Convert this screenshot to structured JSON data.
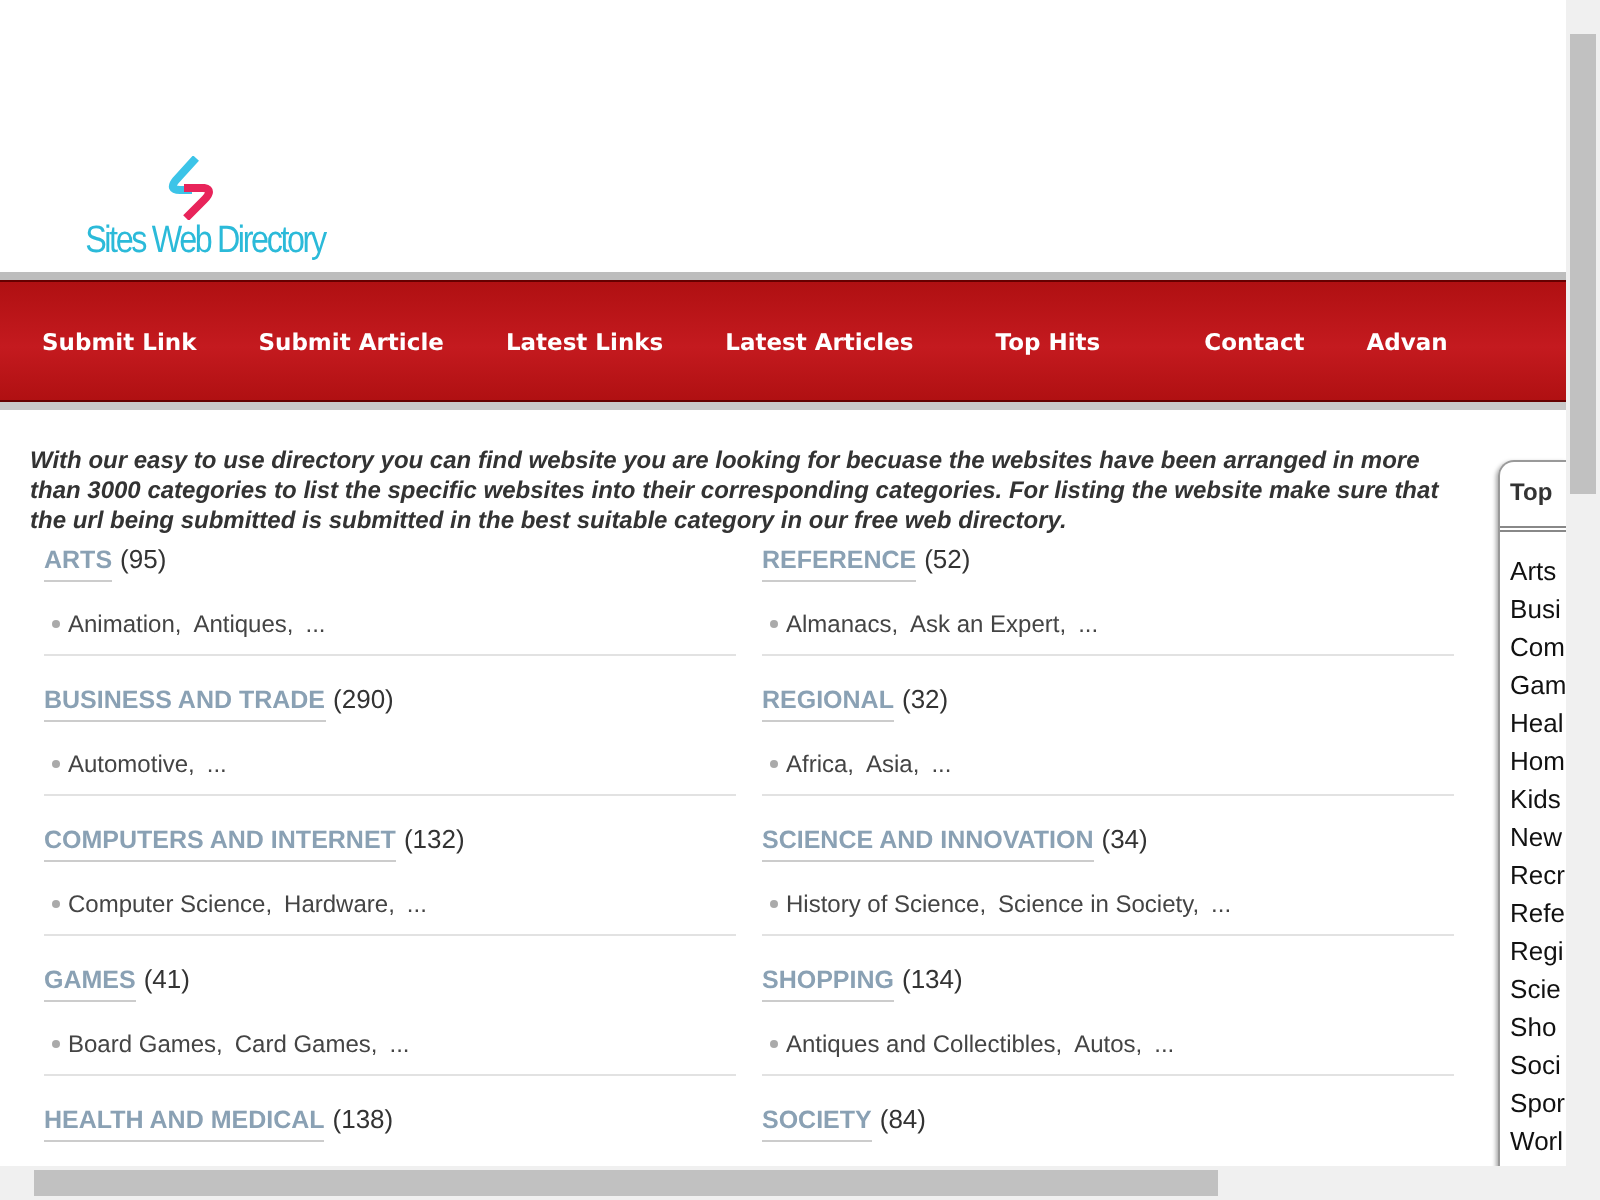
{
  "logo": {
    "text": "Sites Web Directory"
  },
  "nav": [
    "Submit Link",
    "Submit Article",
    "Latest Links",
    "Latest Articles",
    "Top Hits",
    "Contact",
    "Advan"
  ],
  "intro": "With our easy to use directory you can find website you are looking for becuase the websites have been arranged in more than 3000 categories to list the specific websites into their corresponding categories. For listing the website make sure that the url being submitted is submitted in the best suitable category in our free web directory.",
  "categories": [
    {
      "name": "ARTS",
      "count": "(95)",
      "subs": [
        "Animation,",
        "Antiques,",
        "..."
      ]
    },
    {
      "name": "REFERENCE",
      "count": "(52)",
      "subs": [
        "Almanacs,",
        "Ask an Expert,",
        "..."
      ]
    },
    {
      "name": "BUSINESS AND TRADE",
      "count": "(290)",
      "subs": [
        "Automotive,",
        "..."
      ]
    },
    {
      "name": "REGIONAL",
      "count": "(32)",
      "subs": [
        "Africa,",
        "Asia,",
        "..."
      ]
    },
    {
      "name": "COMPUTERS AND INTERNET",
      "count": "(132)",
      "subs": [
        "Computer Science,",
        "Hardware,",
        "..."
      ]
    },
    {
      "name": "SCIENCE AND INNOVATION",
      "count": "(34)",
      "subs": [
        "History of Science,",
        "Science in Society,",
        "..."
      ]
    },
    {
      "name": "GAMES",
      "count": "(41)",
      "subs": [
        "Board Games,",
        "Card Games,",
        "..."
      ]
    },
    {
      "name": "SHOPPING",
      "count": "(134)",
      "subs": [
        "Antiques and Collectibles,",
        "Autos,",
        "..."
      ]
    },
    {
      "name": "HEALTH AND MEDICAL",
      "count": "(138)"
    },
    {
      "name": "SOCIETY",
      "count": "(84)"
    }
  ],
  "sidebar": {
    "title": "Top",
    "items": [
      "Arts",
      "Busi",
      "Com",
      "Gam",
      "Heal",
      "Hom",
      "Kids",
      "New",
      "Recr",
      "Refe",
      "Regi",
      "Scie",
      "Sho",
      "Soci",
      "Spor",
      "Worl"
    ]
  }
}
